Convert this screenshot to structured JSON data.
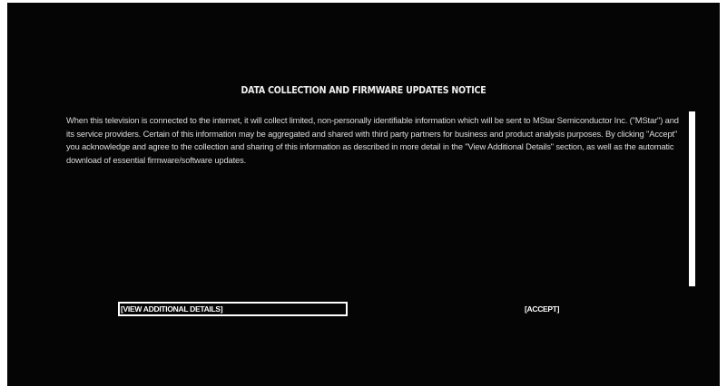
{
  "notice": {
    "title": "DATA COLLECTION AND FIRMWARE UPDATES NOTICE",
    "body": "When this television is connected to the internet, it will collect limited, non-personally identifiable information which will be sent to MStar Semiconductor Inc. (\"MStar\") and its service providers. Certain of this information may be aggregated and shared with third party partners for business and product analysis purposes. By clicking \"Accept\" you acknowledge and agree to the collection and sharing of this information as described in more detail in the \"View Additional Details\" section, as well as the automatic download of essential firmware/software updates."
  },
  "buttons": {
    "view_details_label": "[VIEW ADDITIONAL DETAILS]",
    "accept_label": "[ACCEPT]"
  },
  "colors": {
    "background": "#050505",
    "text": "#ffffff"
  }
}
